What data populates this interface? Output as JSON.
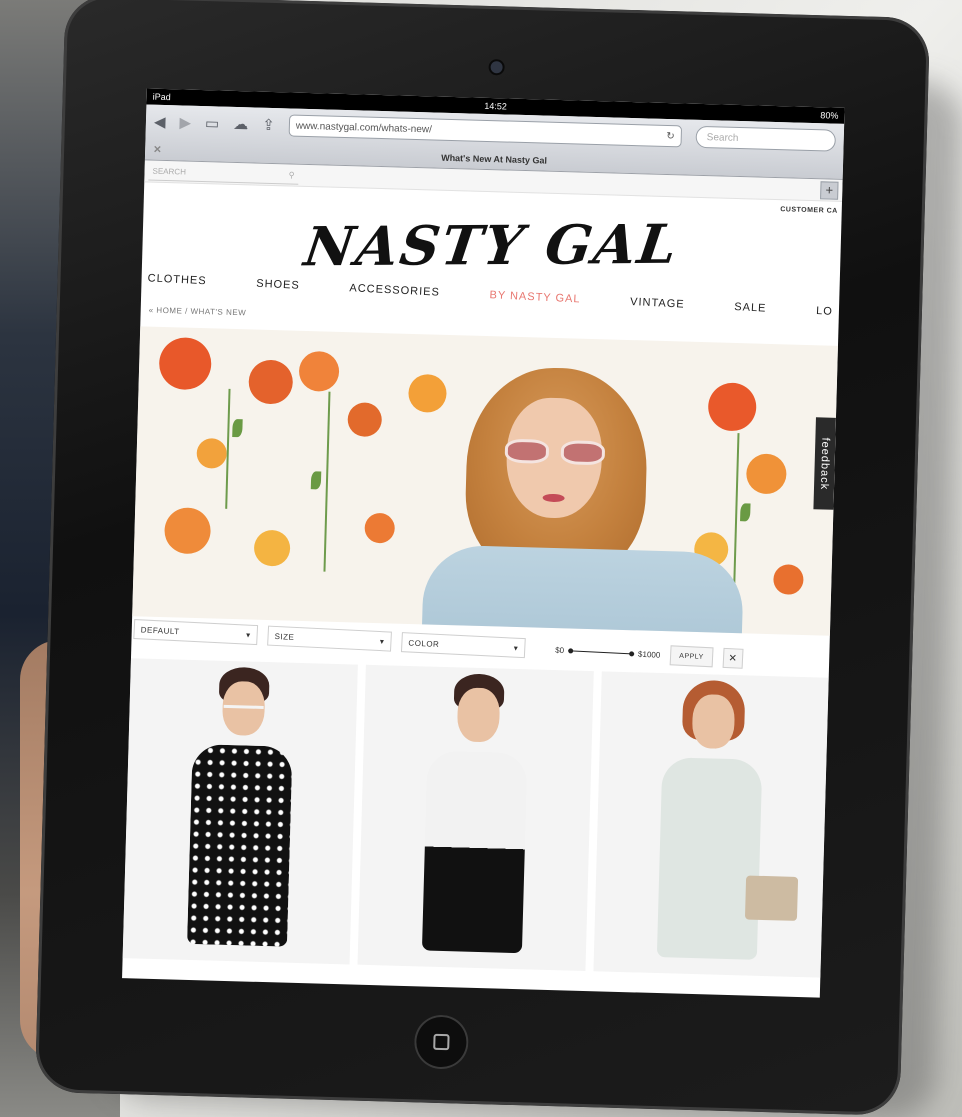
{
  "statusbar": {
    "carrier": "iPad",
    "time": "14:52",
    "battery": "80%"
  },
  "browser": {
    "url": "www.nastygal.com/whats-new/",
    "search_placeholder": "Search",
    "tab_title": "What's New At Nasty Gal"
  },
  "site": {
    "search_placeholder": "SEARCH",
    "customer_care": "CUSTOMER CA",
    "logo": "NASTY GAL",
    "nav": [
      {
        "label": "CLOTHES"
      },
      {
        "label": "SHOES"
      },
      {
        "label": "ACCESSORIES"
      },
      {
        "label": "BY NASTY GAL"
      },
      {
        "label": "VINTAGE"
      },
      {
        "label": "SALE"
      },
      {
        "label": "LO"
      }
    ],
    "breadcrumb": "« HOME / WHAT'S NEW",
    "feedback": "feedback",
    "filters": {
      "sort": "DEFAULT",
      "size": "SIZE",
      "color": "COLOR",
      "price_min": "$0",
      "price_max": "$1000",
      "apply": "APPLY",
      "clear": "✕"
    }
  },
  "colors": {
    "accent": "#e8766f",
    "nav_text": "#222222"
  }
}
